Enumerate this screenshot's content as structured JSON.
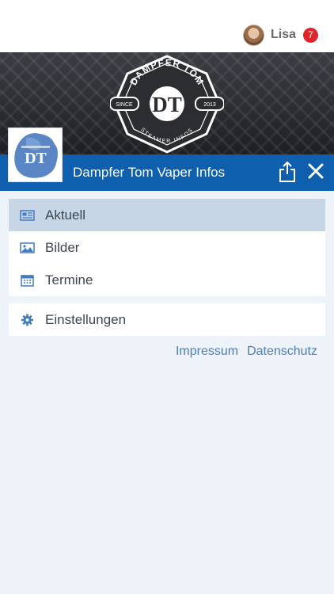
{
  "user": {
    "name": "Lisa",
    "notifications": "7"
  },
  "banner": {
    "brand_top": "DAMPFER TOM",
    "monogram": "DT",
    "since_label": "SINCE",
    "year": "2013",
    "brand_bottom": "STEAMER INFOS"
  },
  "header": {
    "title": "Dampfer Tom Vaper Infos"
  },
  "menu_primary": [
    {
      "label": "Aktuell",
      "icon": "newspaper-icon",
      "active": true
    },
    {
      "label": "Bilder",
      "icon": "image-icon",
      "active": false
    },
    {
      "label": "Termine",
      "icon": "calendar-icon",
      "active": false
    }
  ],
  "menu_secondary": [
    {
      "label": "Einstellungen",
      "icon": "gear-icon"
    }
  ],
  "footer_links": {
    "impressum": "Impressum",
    "datenschutz": "Datenschutz"
  },
  "colors": {
    "header_blue": "#0e5fad",
    "active_item": "#c7d6e7",
    "background": "#eef2f9",
    "badge": "#e0262a",
    "link": "#4f7fb0"
  }
}
